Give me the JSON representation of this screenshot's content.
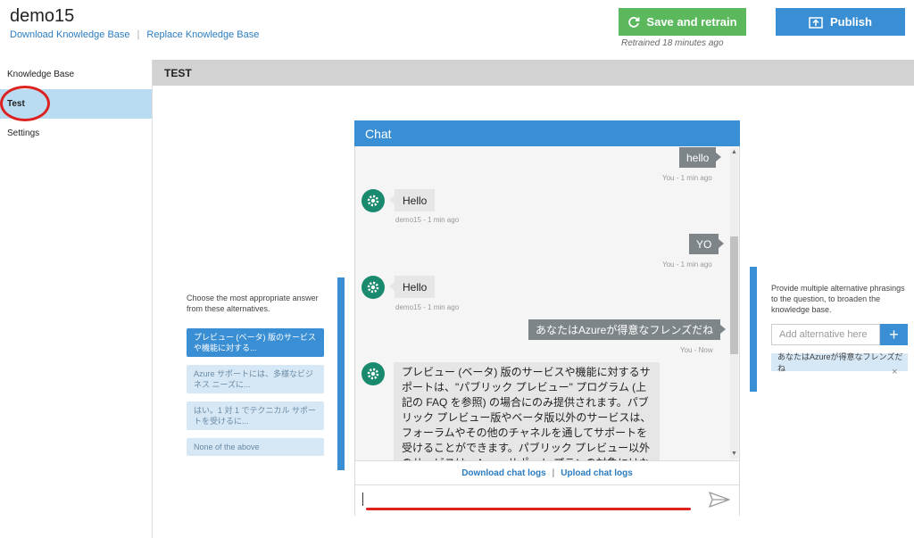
{
  "header": {
    "kb_name": "demo15",
    "download_link": "Download Knowledge Base",
    "replace_link": "Replace Knowledge Base",
    "save_button": "Save and retrain",
    "publish_button": "Publish",
    "retrained_status": "Retrained 18 minutes ago"
  },
  "sidebar": {
    "items": [
      {
        "label": "Knowledge Base"
      },
      {
        "label": "Test"
      },
      {
        "label": "Settings"
      }
    ]
  },
  "test_header": "TEST",
  "alternatives": {
    "intro": "Choose the most appropriate answer from these alternatives.",
    "options": [
      "プレビュー (ベータ) 版のサービスや機能に対する...",
      "Azure サポートには、多様なビジネス ニーズに...",
      "はい。1 対 1 でテクニカル サポートを受けるに...",
      "None of the above"
    ]
  },
  "chat": {
    "title": "Chat",
    "messages": [
      {
        "from": "user",
        "text": "hello",
        "meta": "You - 1 min ago"
      },
      {
        "from": "bot",
        "text": "Hello",
        "meta": "demo15 - 1 min ago"
      },
      {
        "from": "user",
        "text": "YO",
        "meta": "You - 1 min ago"
      },
      {
        "from": "bot",
        "text": "Hello",
        "meta": "demo15 - 1 min ago"
      },
      {
        "from": "user",
        "text": "あなたはAzureが得意なフレンズだね",
        "meta": "You - Now"
      },
      {
        "from": "bot",
        "text": "プレビュー (ベータ) 版のサービスや機能に対するサポートは、\"パブリック プレビュー\" プログラム (上記の FAQ を参照) の場合にのみ提供されます。パブリック プレビュー版やベータ版以外のサービスは、フォーラムやその他のチャネルを通してサポートを受けることができます。パブリック プレビュー以外のサービスは、Azure サポート プランの対象にはなりま"
      }
    ],
    "download_logs": "Download chat logs",
    "upload_logs": "Upload chat logs",
    "input_value": ""
  },
  "right_panel": {
    "intro": "Provide multiple alternative phrasings to the question, to broaden the knowledge base.",
    "input_placeholder": "Add alternative here",
    "add_button": "+",
    "tag": "あなたはAzureが得意なフレンズだね",
    "close": "×"
  },
  "colors": {
    "accent": "#3a8fd4",
    "save_green": "#5cb85c",
    "annotation_red": "#dd2222"
  }
}
